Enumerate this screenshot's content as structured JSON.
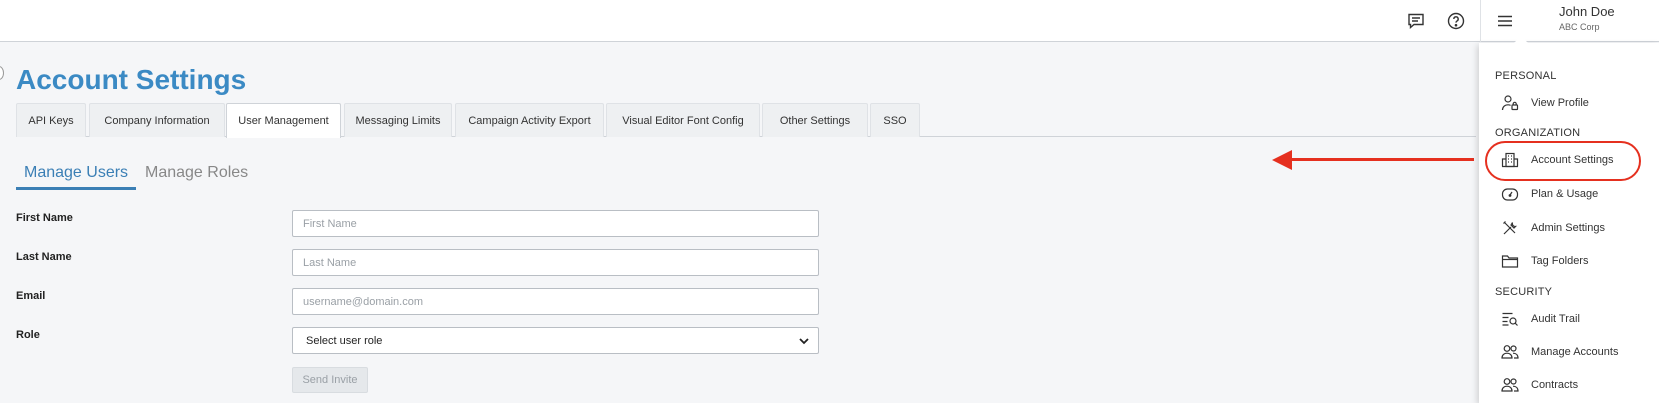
{
  "user": {
    "name": "John Doe",
    "org": "ABC Corp"
  },
  "topbar": {
    "icons": [
      "feedback-icon",
      "help-icon",
      "hamburger-menu-icon"
    ]
  },
  "page": {
    "title": "Account Settings"
  },
  "tabs": [
    {
      "label": "API Keys",
      "active": false
    },
    {
      "label": "Company Information",
      "active": false
    },
    {
      "label": "User Management",
      "active": true
    },
    {
      "label": "Messaging Limits",
      "active": false
    },
    {
      "label": "Campaign Activity Export",
      "active": false
    },
    {
      "label": "Visual Editor Font Config",
      "active": false
    },
    {
      "label": "Other Settings",
      "active": false
    },
    {
      "label": "SSO",
      "active": false
    }
  ],
  "subtabs": [
    {
      "label": "Manage Users",
      "active": true
    },
    {
      "label": "Manage Roles",
      "active": false
    }
  ],
  "form": {
    "first_name": {
      "label": "First Name",
      "placeholder": "First Name",
      "value": ""
    },
    "last_name": {
      "label": "Last Name",
      "placeholder": "Last Name",
      "value": ""
    },
    "email": {
      "label": "Email",
      "placeholder": "username@domain.com",
      "value": ""
    },
    "role": {
      "label": "Role",
      "selected": "Select user role"
    },
    "send_label": "Send Invite"
  },
  "menu": {
    "sections": [
      {
        "title": "PERSONAL",
        "items": [
          {
            "label": "View Profile",
            "icon": "user-lock-icon"
          }
        ]
      },
      {
        "title": "ORGANIZATION",
        "items": [
          {
            "label": "Account Settings",
            "icon": "building-icon",
            "highlighted": true
          },
          {
            "label": "Plan & Usage",
            "icon": "gauge-icon"
          },
          {
            "label": "Admin Settings",
            "icon": "tools-icon"
          },
          {
            "label": "Tag Folders",
            "icon": "folder-icon"
          }
        ]
      },
      {
        "title": "SECURITY",
        "items": [
          {
            "label": "Audit Trail",
            "icon": "list-search-icon"
          },
          {
            "label": "Manage Accounts",
            "icon": "users-icon"
          },
          {
            "label": "Contracts",
            "icon": "users-icon"
          }
        ]
      }
    ]
  },
  "annotation": {
    "color": "#e5301f"
  },
  "colors": {
    "accent": "#3b8ac4",
    "title": "#3b8ac4"
  }
}
